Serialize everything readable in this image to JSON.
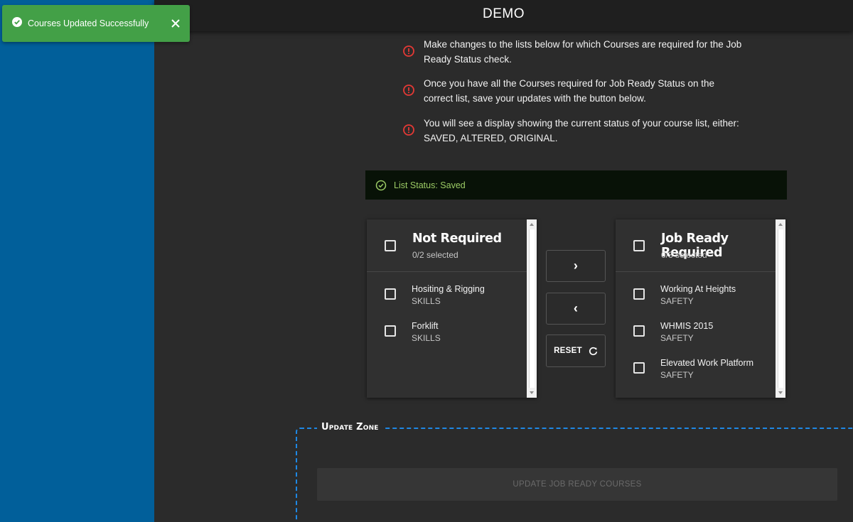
{
  "header": {
    "title": "DEMO"
  },
  "toast": {
    "message": "Courses Updated Successfully"
  },
  "instructions": [
    {
      "text": "Make changes to the lists below for which Courses are required for the Job Ready Status check."
    },
    {
      "text": "Once you have all the Courses required for Job Ready Status on the correct list, save your updates with the button below."
    },
    {
      "text": "You will see a display showing the current status of your course list, either: SAVED, ALTERED, ORIGINAL."
    }
  ],
  "status": {
    "label": "List Status: Saved"
  },
  "left_list": {
    "title": "Not Required",
    "count": "0/2 selected",
    "items": [
      {
        "name": "Hositing & Rigging",
        "category": "SKILLS"
      },
      {
        "name": "Forklift",
        "category": "SKILLS"
      }
    ]
  },
  "right_list": {
    "title": "Job Ready Required",
    "count": "0/3 selected",
    "items": [
      {
        "name": "Working At Heights",
        "category": "SAFETY"
      },
      {
        "name": "WHMIS 2015",
        "category": "SAFETY"
      },
      {
        "name": "Elevated Work Platform",
        "category": "SAFETY"
      }
    ]
  },
  "transfer": {
    "move_right": "›",
    "move_left": "‹",
    "reset": "RESET"
  },
  "update_zone": {
    "legend": "Update Zone",
    "button": "UPDATE JOB READY COURSES"
  },
  "colors": {
    "accent_blue": "#015f9a",
    "toast_green": "#43a047",
    "warning_red": "#e53935",
    "status_green": "#9ccc65",
    "dash_blue": "#1e88e5"
  },
  "icons": {
    "toast": "check-circle-icon",
    "warn": "alert-circle-icon",
    "status": "check-circle-outline-icon",
    "reset": "refresh-icon"
  }
}
